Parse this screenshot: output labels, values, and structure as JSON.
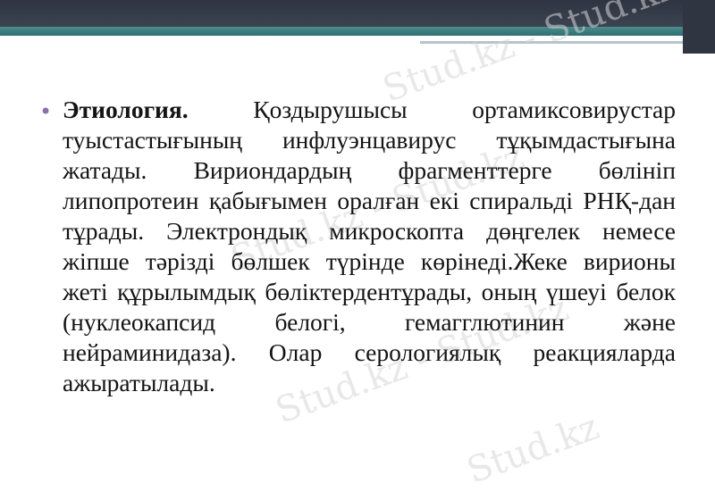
{
  "slide": {
    "bullet_glyph": "•",
    "lead": "Этиология.",
    "body": " Қоздырушысы ортамиксовирустар туыстастығының инфлуэнцавирус тұқымдастығына жатады. Вириондардың фрагменттерге бөлініп липопротеин қабығымен оралған екі спиральді РНҚ-дан тұрады. Электрондық микроскопта дөңгелек немесе жіпше тәрізді бөлшек түрінде көрінеді.Жеке вирионы жеті құрылымдық бөліктердентұрады, оның үшеуі белок (нуклеокапсид белогі, гемагглютинин және нейраминидаза). Олар серологиялық реакцияларда ажыратылады."
  },
  "watermarks": [
    "Stud.kz - Stud.kz",
    "Stud.kz - Stud.kz",
    "Stud.kz - Stud.kz",
    "Stud.kz"
  ],
  "colors": {
    "header_dark": "#2e3440",
    "header_accent": "#4b8c8c",
    "bullet": "#8c6fb1"
  }
}
